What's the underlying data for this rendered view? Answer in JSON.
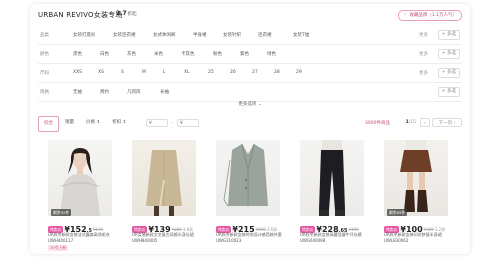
{
  "header": {
    "brand": "URBAN REVIVO女装专场",
    "count_value": "2.7",
    "count_unit": "折起",
    "fav_label": "收藏品牌（1.1万人气）"
  },
  "filters": [
    {
      "label": "品类",
      "options": [
        "女装打底衫",
        "女装连衣裙",
        "女式休闲裤",
        "半身裙",
        "女装针织",
        "连衣裙",
        "女装T恤"
      ],
      "more": "更多",
      "multi": "+ 多选"
    },
    {
      "label": "颜色",
      "options": [
        "黑色",
        "白色",
        "灰色",
        "米色",
        "卡其色",
        "粉色",
        "紫色",
        "绿色"
      ],
      "more": "更多",
      "multi": "+ 多选"
    },
    {
      "label": "尺码",
      "options": [
        "XXS",
        "XS",
        "S",
        "M",
        "L",
        "XL",
        "25",
        "26",
        "27",
        "28",
        "29"
      ],
      "more": "更多",
      "multi": "+ 多选"
    },
    {
      "label": "风格",
      "options": [
        "无袖",
        "简约",
        "几何风",
        "长袖"
      ],
      "more": "",
      "multi": "+ 多选"
    }
  ],
  "show_more": "更多选项 ⌄",
  "sortbar": {
    "tabs": [
      "综合",
      "销量",
      "价格 ↕",
      "折扣 ↕"
    ],
    "price_min": "¥",
    "price_max": "¥",
    "result": "3000件商品",
    "page_current": "1",
    "page_total": "/15",
    "prev": "‹",
    "next": "下一页 ›"
  },
  "products": [
    {
      "stock": "剩余92件",
      "tag": "特卖价",
      "price_int": "¥152",
      "price_dec": ".5",
      "orig": "¥179",
      "disc": "",
      "title": "UR秋冬新款女装法式露肩高领毛衣UWH440117",
      "chip": "29号上新"
    },
    {
      "stock": "",
      "tag": "特卖价",
      "price_int": "¥139",
      "price_dec": "",
      "orig": "¥289",
      "disc": "4.8折",
      "title": "UR女装新款文艺复古风格半身长裙UWH840005",
      "chip": ""
    },
    {
      "stock": "",
      "tag": "特卖价",
      "price_int": "¥215",
      "price_dec": "",
      "orig": "¥599",
      "disc": "3.6折",
      "title": "UR秋冬新款女装时尚设计感西装外套UWG310023",
      "chip": ""
    },
    {
      "stock": "",
      "tag": "特卖价",
      "price_int": "¥228",
      "price_dec": ".65",
      "orig": "¥399",
      "disc": "",
      "title": "UR秋冬新款女装高腰显瘦牛仔长裤UWG640098",
      "chip": ""
    },
    {
      "stock": "剩余65件",
      "tag": "特卖价",
      "price_int": "¥100",
      "price_dec": "",
      "orig": "¥309",
      "disc": "3.2折",
      "title": "UR秋冬新款女装印花拼接半身裙UWL830062",
      "chip": ""
    }
  ],
  "colors": {
    "accent": "#c2507a",
    "tag": "#e857a6"
  }
}
